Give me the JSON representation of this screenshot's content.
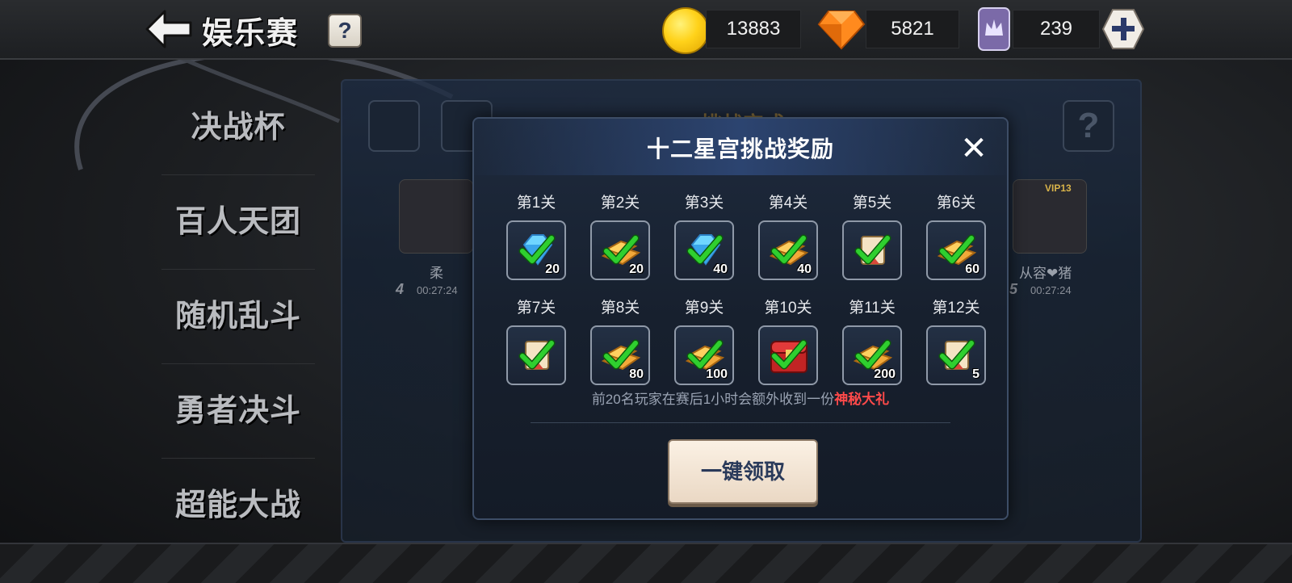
{
  "header": {
    "title": "娱乐赛",
    "help_label": "?",
    "coins": "13883",
    "gems": "5821",
    "tokens": "239",
    "plus_label": "+"
  },
  "menu": {
    "items": [
      "决战杯",
      "百人天团",
      "随机乱斗",
      "勇者决斗",
      "超能大战"
    ]
  },
  "background": {
    "title": "挑战完成",
    "help_label": "?",
    "player_left": {
      "name": "柔",
      "rank": "4",
      "time": "00:27:24"
    },
    "player_right": {
      "name": "从容❤猪",
      "rank": "5",
      "time": "00:27:24",
      "badge": "VIP13"
    }
  },
  "modal": {
    "title": "十二星宫挑战奖励",
    "close_label": "✕",
    "levels": [
      {
        "label": "第1关",
        "qty": "20",
        "icon": "diamond-icon"
      },
      {
        "label": "第2关",
        "qty": "20",
        "icon": "gold-bars-icon"
      },
      {
        "label": "第3关",
        "qty": "40",
        "icon": "diamond-icon"
      },
      {
        "label": "第4关",
        "qty": "40",
        "icon": "gold-bars-icon"
      },
      {
        "label": "第5关",
        "qty": "",
        "icon": "scroll-icon"
      },
      {
        "label": "第6关",
        "qty": "60",
        "icon": "gold-bars-icon"
      },
      {
        "label": "第7关",
        "qty": "",
        "icon": "scroll-icon"
      },
      {
        "label": "第8关",
        "qty": "80",
        "icon": "gold-bars-icon"
      },
      {
        "label": "第9关",
        "qty": "100",
        "icon": "gold-bars-icon"
      },
      {
        "label": "第10关",
        "qty": "",
        "icon": "treasure-chest-icon"
      },
      {
        "label": "第11关",
        "qty": "200",
        "icon": "gold-bars-icon"
      },
      {
        "label": "第12关",
        "qty": "5",
        "icon": "scroll-icon"
      }
    ],
    "note_prefix": "前20名玩家在赛后1小时会额外收到一份",
    "note_highlight": "神秘大礼",
    "claim_label": "一键领取"
  },
  "colors": {
    "highlight": "#ff4a4a",
    "check": "#2fcf2f",
    "modal_bg": "#17202e",
    "button_bg": "#f4e6d4"
  }
}
